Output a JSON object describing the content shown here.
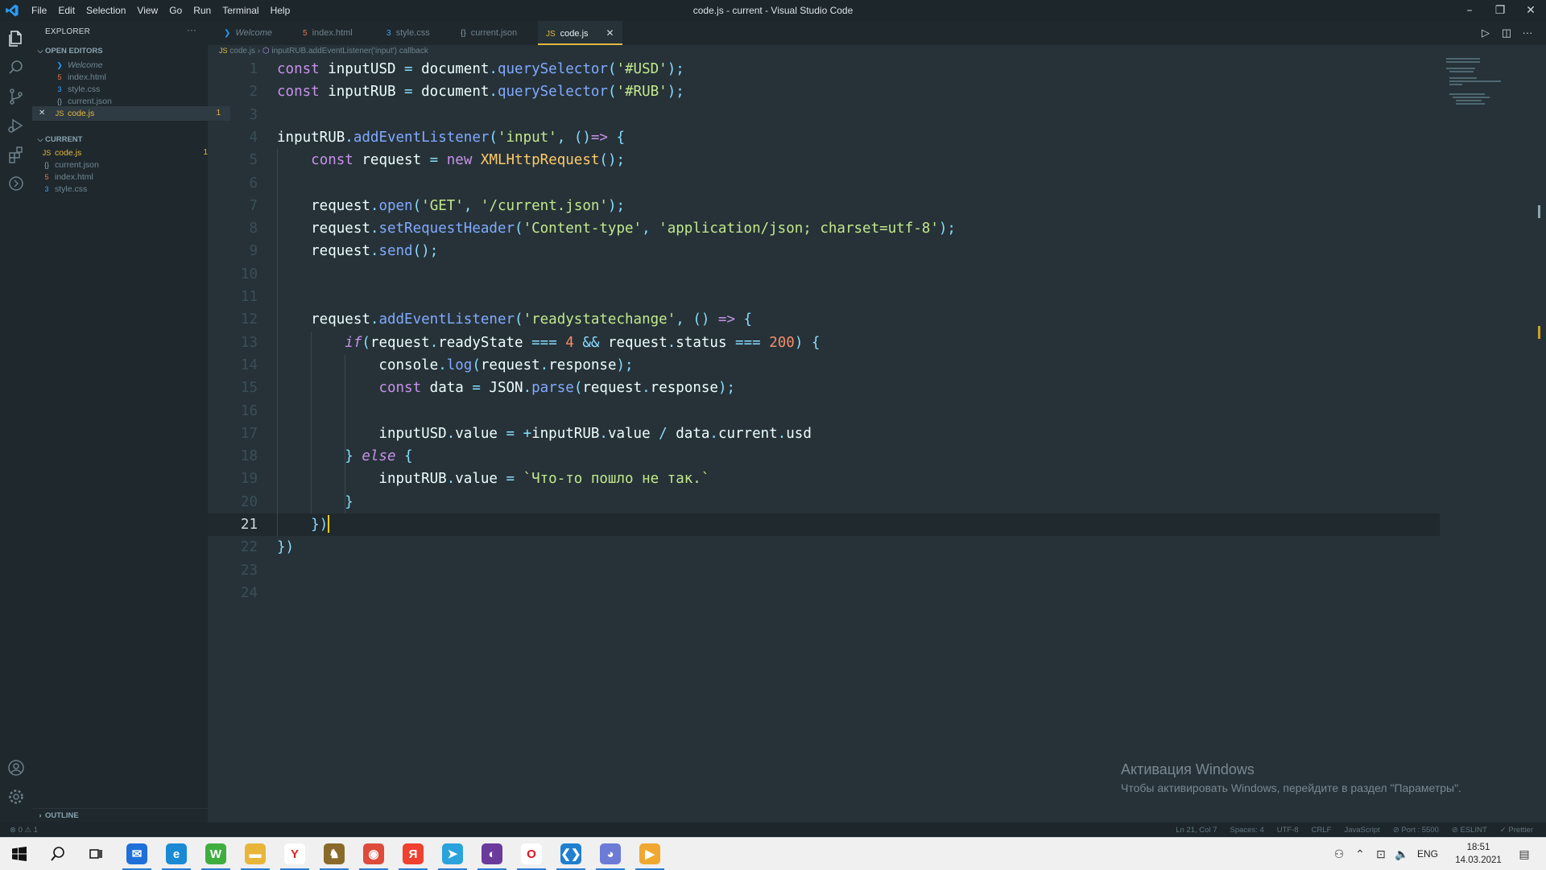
{
  "window": {
    "title": "code.js - current - Visual Studio Code",
    "menu": [
      "File",
      "Edit",
      "Selection",
      "View",
      "Go",
      "Run",
      "Terminal",
      "Help"
    ]
  },
  "sidebar": {
    "header": "EXPLORER",
    "open_editors_label": "OPEN EDITORS",
    "open_editors": [
      {
        "name": "Welcome",
        "icon": "vscode-icon",
        "italic": true
      },
      {
        "name": "index.html",
        "icon": "html-icon"
      },
      {
        "name": "style.css",
        "icon": "css-icon"
      },
      {
        "name": "current.json",
        "icon": "json-icon"
      },
      {
        "name": "code.js",
        "icon": "js-icon",
        "badge": "1",
        "active": true
      }
    ],
    "folder_label": "CURRENT",
    "folder_files": [
      {
        "name": "code.js",
        "icon": "js-icon",
        "badge": "1"
      },
      {
        "name": "current.json",
        "icon": "json-icon"
      },
      {
        "name": "index.html",
        "icon": "html-icon"
      },
      {
        "name": "style.css",
        "icon": "css-icon"
      }
    ],
    "outline_label": "OUTLINE"
  },
  "tabs": [
    {
      "label": "Welcome",
      "icon": "vscode-icon"
    },
    {
      "label": "index.html",
      "icon": "html-icon"
    },
    {
      "label": "style.css",
      "icon": "css-icon"
    },
    {
      "label": "current.json",
      "icon": "json-icon"
    },
    {
      "label": "code.js",
      "icon": "js-icon",
      "active": true
    }
  ],
  "breadcrumb": {
    "file": "code.js",
    "symbol": "inputRUB.addEventListener('input') callback"
  },
  "editor": {
    "current_line": 21,
    "lines": [
      [
        [
          "kw",
          "const"
        ],
        [
          "id",
          " inputUSD "
        ],
        [
          "op",
          "="
        ],
        [
          "id",
          " document"
        ],
        [
          "op",
          "."
        ],
        [
          "fn",
          "querySelector"
        ],
        [
          "pn",
          "("
        ],
        [
          "str",
          "'#USD'"
        ],
        [
          "pn",
          ")"
        ],
        [
          "op",
          ";"
        ]
      ],
      [
        [
          "kw",
          "const"
        ],
        [
          "id",
          " inputRUB "
        ],
        [
          "op",
          "="
        ],
        [
          "id",
          " document"
        ],
        [
          "op",
          "."
        ],
        [
          "fn",
          "querySelector"
        ],
        [
          "pn",
          "("
        ],
        [
          "str",
          "'#RUB'"
        ],
        [
          "pn",
          ")"
        ],
        [
          "op",
          ";"
        ]
      ],
      [],
      [
        [
          "id",
          "inputRUB"
        ],
        [
          "op",
          "."
        ],
        [
          "fn",
          "addEventListener"
        ],
        [
          "pn",
          "("
        ],
        [
          "str",
          "'input'"
        ],
        [
          "op",
          ", "
        ],
        [
          "pn",
          "()"
        ],
        [
          "kw",
          "=>"
        ],
        [
          "pn",
          " {"
        ]
      ],
      [
        [
          "id",
          "    "
        ],
        [
          "kw",
          "const"
        ],
        [
          "id",
          " request "
        ],
        [
          "op",
          "="
        ],
        [
          "kw",
          " new"
        ],
        [
          "cls",
          " XMLHttpRequest"
        ],
        [
          "pn",
          "()"
        ],
        [
          "op",
          ";"
        ]
      ],
      [],
      [
        [
          "id",
          "    request"
        ],
        [
          "op",
          "."
        ],
        [
          "fn",
          "open"
        ],
        [
          "pn",
          "("
        ],
        [
          "str",
          "'GET'"
        ],
        [
          "op",
          ", "
        ],
        [
          "str",
          "'/current.json'"
        ],
        [
          "pn",
          ")"
        ],
        [
          "op",
          ";"
        ]
      ],
      [
        [
          "id",
          "    request"
        ],
        [
          "op",
          "."
        ],
        [
          "fn",
          "setRequestHeader"
        ],
        [
          "pn",
          "("
        ],
        [
          "str",
          "'Content-type'"
        ],
        [
          "op",
          ", "
        ],
        [
          "str",
          "'application/json; charset=utf-8'"
        ],
        [
          "pn",
          ")"
        ],
        [
          "op",
          ";"
        ]
      ],
      [
        [
          "id",
          "    request"
        ],
        [
          "op",
          "."
        ],
        [
          "fn",
          "send"
        ],
        [
          "pn",
          "()"
        ],
        [
          "op",
          ";"
        ]
      ],
      [],
      [],
      [
        [
          "id",
          "    request"
        ],
        [
          "op",
          "."
        ],
        [
          "fn",
          "addEventListener"
        ],
        [
          "pn",
          "("
        ],
        [
          "str",
          "'readystatechange'"
        ],
        [
          "op",
          ", "
        ],
        [
          "pn",
          "()"
        ],
        [
          "kw",
          " =>"
        ],
        [
          "pn",
          " {"
        ]
      ],
      [
        [
          "id",
          "        "
        ],
        [
          "kwi",
          "if"
        ],
        [
          "pn",
          "("
        ],
        [
          "id",
          "request"
        ],
        [
          "op",
          "."
        ],
        [
          "id",
          "readyState "
        ],
        [
          "op",
          "==="
        ],
        [
          "num",
          " 4"
        ],
        [
          "op",
          " &&"
        ],
        [
          "id",
          " request"
        ],
        [
          "op",
          "."
        ],
        [
          "id",
          "status "
        ],
        [
          "op",
          "==="
        ],
        [
          "num",
          " 200"
        ],
        [
          "pn",
          ")"
        ],
        [
          "pn",
          " {"
        ]
      ],
      [
        [
          "id",
          "            console"
        ],
        [
          "op",
          "."
        ],
        [
          "fn",
          "log"
        ],
        [
          "pn",
          "("
        ],
        [
          "id",
          "request"
        ],
        [
          "op",
          "."
        ],
        [
          "id",
          "response"
        ],
        [
          "pn",
          ")"
        ],
        [
          "op",
          ";"
        ]
      ],
      [
        [
          "id",
          "            "
        ],
        [
          "kw",
          "const"
        ],
        [
          "id",
          " data "
        ],
        [
          "op",
          "="
        ],
        [
          "id",
          " JSON"
        ],
        [
          "op",
          "."
        ],
        [
          "fn",
          "parse"
        ],
        [
          "pn",
          "("
        ],
        [
          "id",
          "request"
        ],
        [
          "op",
          "."
        ],
        [
          "id",
          "response"
        ],
        [
          "pn",
          ")"
        ],
        [
          "op",
          ";"
        ]
      ],
      [],
      [
        [
          "id",
          "            inputUSD"
        ],
        [
          "op",
          "."
        ],
        [
          "id",
          "value "
        ],
        [
          "op",
          "="
        ],
        [
          "op",
          " +"
        ],
        [
          "id",
          "inputRUB"
        ],
        [
          "op",
          "."
        ],
        [
          "id",
          "value "
        ],
        [
          "op",
          "/"
        ],
        [
          "id",
          " data"
        ],
        [
          "op",
          "."
        ],
        [
          "id",
          "current"
        ],
        [
          "op",
          "."
        ],
        [
          "id",
          "usd"
        ]
      ],
      [
        [
          "pn",
          "        }"
        ],
        [
          "kwi",
          " else"
        ],
        [
          "pn",
          " {"
        ]
      ],
      [
        [
          "id",
          "            inputRUB"
        ],
        [
          "op",
          "."
        ],
        [
          "id",
          "value "
        ],
        [
          "op",
          "="
        ],
        [
          "str",
          " `Что-то пошло не так.`"
        ]
      ],
      [
        [
          "pn",
          "        }"
        ]
      ],
      [
        [
          "id",
          "    "
        ],
        [
          "pn",
          "})"
        ],
        [
          "cursor",
          ""
        ]
      ],
      [
        [
          "pn",
          "})"
        ]
      ],
      [],
      []
    ]
  },
  "status_bar": {
    "left": "⊗ 0 ⚠ 1",
    "items": [
      "Ln 21, Col 7",
      "Spaces: 4",
      "UTF-8",
      "CRLF",
      "JavaScript",
      "⊘ Port : 5500",
      "⊘ ESLINT",
      "✓ Prettier"
    ]
  },
  "watermark": {
    "title": "Активация Windows",
    "subtitle": "Чтобы активировать Windows, перейдите в раздел \"Параметры\"."
  },
  "taskbar": {
    "apps": [
      {
        "name": "mail-icon",
        "color": "#1e6fd9",
        "glyph": "✉"
      },
      {
        "name": "edge-icon",
        "color": "#1a8ad4",
        "glyph": "e"
      },
      {
        "name": "whatsapp-icon",
        "color": "#3fae3f",
        "glyph": "W"
      },
      {
        "name": "file-explorer-icon",
        "color": "#e8b53a",
        "glyph": "▬"
      },
      {
        "name": "yandex-icon",
        "color": "#ffffff",
        "glyph": "Y",
        "fg": "#e02020"
      },
      {
        "name": "cs-icon",
        "color": "#8a6a2a",
        "glyph": "♞"
      },
      {
        "name": "chrome-icon",
        "color": "#de4b3b",
        "glyph": "◉"
      },
      {
        "name": "yandex-browser-icon",
        "color": "#f04030",
        "glyph": "Я"
      },
      {
        "name": "telegram-icon",
        "color": "#2aa3dd",
        "glyph": "➤"
      },
      {
        "name": "tor-icon",
        "color": "#6a3b9c",
        "glyph": "◐"
      },
      {
        "name": "opera-icon",
        "color": "#ffffff",
        "glyph": "O",
        "fg": "#e01020"
      },
      {
        "name": "vscode-icon",
        "color": "#1f7fd0",
        "glyph": "❮❯"
      },
      {
        "name": "discord-icon",
        "color": "#6b7bd6",
        "glyph": "◕"
      },
      {
        "name": "media-icon",
        "color": "#f0a830",
        "glyph": "▶"
      }
    ],
    "lang": "ENG",
    "time": "18:51",
    "date": "14.03.2021"
  }
}
